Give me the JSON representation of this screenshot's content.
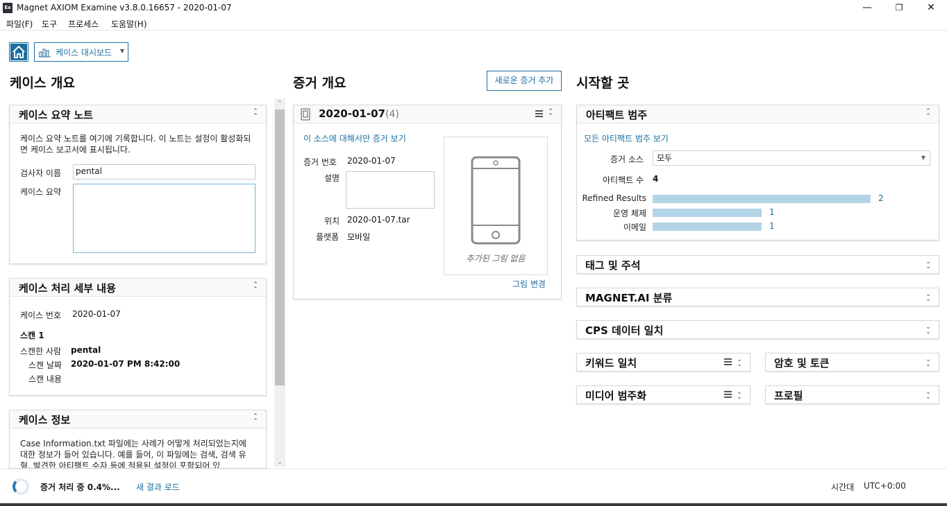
{
  "window": {
    "title": "Magnet AXIOM Examine v3.8.0.16657 - 2020-01-07",
    "app_icon_text": "Ex",
    "minimize": "—",
    "restore": "❐",
    "close": "✕"
  },
  "menu": [
    "파일(F)",
    "도구",
    "프로세스",
    "도움말(H)"
  ],
  "toolbar": {
    "dashboard_label": "케이스 대시보드"
  },
  "case_overview": {
    "title": "케이스 개요",
    "summary_note": {
      "title": "케이스 요약 노트",
      "description": "케이스 요약 노트를 여기에 기록합니다. 이 노트는 설정이 활성화되면 케이스 보고서에 표시됩니다.",
      "examiner_label": "검사자 이름",
      "examiner_value": "pental",
      "summary_label": "케이스 요약"
    },
    "processing": {
      "title": "케이스 처리 세부 내용",
      "case_number_label": "케이스 번호",
      "case_number_value": "2020-01-07",
      "scan_heading": "스캔 1",
      "scanned_by_label": "스캔한 사람",
      "scanned_by_value": "pental",
      "scan_date_label": "스캔 날짜",
      "scan_date_value": "2020-01-07 PM 8:42:00",
      "scan_content_label": "스캔 내용"
    },
    "case_info": {
      "title": "케이스 정보",
      "description": "Case Information.txt 파일에는 사례가 어떻게 처리되었는지에 대한 정보가 들어 있습니다. 예를 들어, 이 파일에는 검색, 검색 유형, 발견한 아티팩트 수자 등에 적용된 설정이 포함되어 있"
    }
  },
  "evidence_overview": {
    "title": "증거 개요",
    "add_button": "새로운 증거 추가",
    "source": {
      "name": "2020-01-07",
      "count": "(4)",
      "view_link": "이 소스에 대해서만 증거 보기",
      "evidence_number_label": "증거 번호",
      "evidence_number_value": "2020-01-07",
      "description_label": "설명",
      "location_label": "위치",
      "location_value": "2020-01-07.tar",
      "platform_label": "플랫폼",
      "platform_value": "모바일",
      "no_image_text": "추가된 그림 없음",
      "change_image_link": "그림 변경"
    }
  },
  "start_here": {
    "title": "시작할 곳",
    "artifact_categories": {
      "title": "아티팩트 범주",
      "view_all_link": "모든 아티팩트 범주 보기",
      "source_label": "증거 소스",
      "source_value": "모두",
      "count_label": "아티팩트 수",
      "count_value": "4",
      "bars": [
        {
          "label": "Refined Results",
          "value": 2
        },
        {
          "label": "운영 체제",
          "value": 1
        },
        {
          "label": "이메일",
          "value": 1
        }
      ]
    },
    "tags": "태그 및 주석",
    "magnet_ai": "MAGNET.AI 분류",
    "cps": "CPS 데이터 일치",
    "keyword": "키워드 일치",
    "crypto": "암호 및 토큰",
    "media": "미디어 범주화",
    "profile": "프로필"
  },
  "status": {
    "processing_text": "증거 처리 중 0.4%...",
    "load_results": "새 결과 로드",
    "timezone_label": "시간대",
    "timezone_value": "UTC+0:00"
  },
  "colors": {
    "accent": "#1b6e9e",
    "bar": "#b3d4e6"
  }
}
